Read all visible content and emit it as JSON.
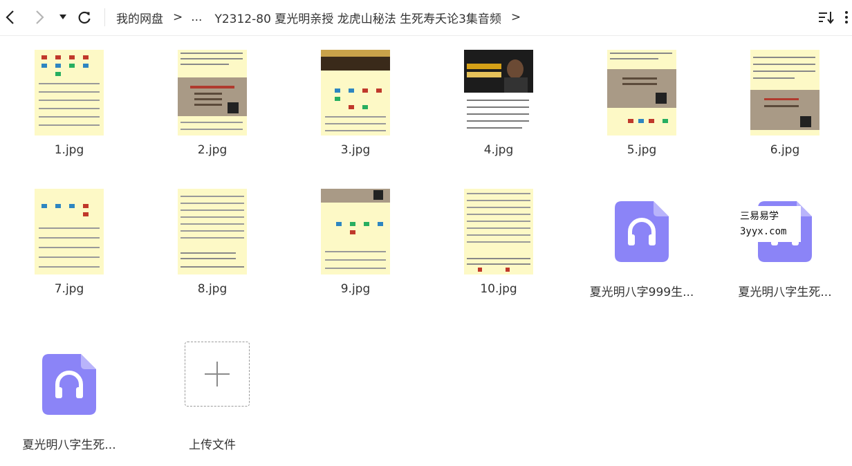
{
  "breadcrumbs": [
    "我的网盘",
    "...",
    "Y2312-80 夏光明亲授 龙虎山秘法 生死寿夭论3集音频"
  ],
  "files": [
    {
      "name": "1.jpg",
      "type": "image"
    },
    {
      "name": "2.jpg",
      "type": "image"
    },
    {
      "name": "3.jpg",
      "type": "image"
    },
    {
      "name": "4.jpg",
      "type": "image"
    },
    {
      "name": "5.jpg",
      "type": "image"
    },
    {
      "name": "6.jpg",
      "type": "image"
    },
    {
      "name": "7.jpg",
      "type": "image"
    },
    {
      "name": "8.jpg",
      "type": "image"
    },
    {
      "name": "9.jpg",
      "type": "image"
    },
    {
      "name": "10.jpg",
      "type": "image"
    },
    {
      "name": "夏光明八字999生...",
      "type": "audio"
    },
    {
      "name": "夏光明八字生死...",
      "type": "audio"
    },
    {
      "name": "夏光明八字生死...",
      "type": "audio"
    }
  ],
  "upload_label": "上传文件",
  "watermark": {
    "line1": "三易易学",
    "line2": "3yyx.com"
  },
  "colors": {
    "audio": "#8b84f7",
    "audio_fold": "#b9b4fb",
    "paper": "#fdf9c6"
  }
}
